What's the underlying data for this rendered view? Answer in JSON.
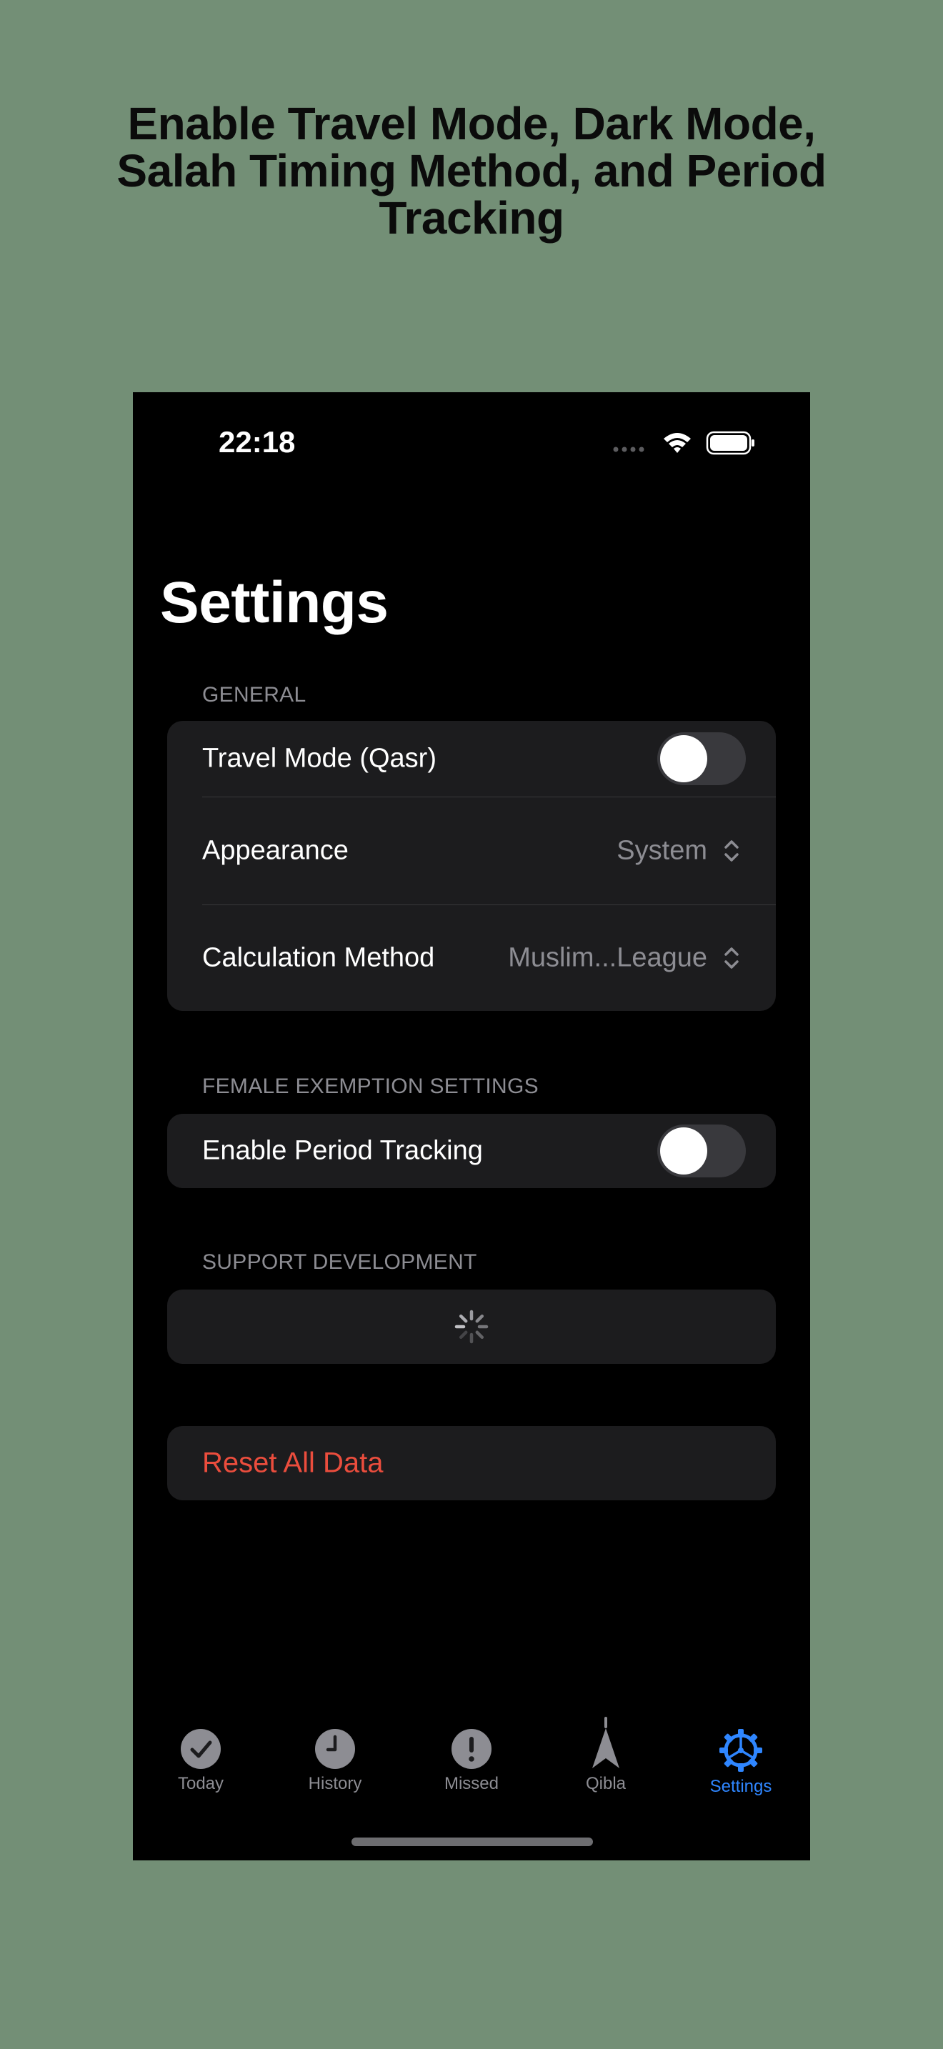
{
  "headline": "Enable Travel Mode, Dark Mode,\nSalah Timing Method, and Period\nTracking",
  "status_bar": {
    "time": "22:18"
  },
  "page_title": "Settings",
  "sections": {
    "general": {
      "header": "GENERAL",
      "travel_mode": {
        "label": "Travel Mode (Qasr)",
        "enabled": false
      },
      "appearance": {
        "label": "Appearance",
        "value": "System"
      },
      "calculation_method": {
        "label": "Calculation Method",
        "value": "Muslim...League"
      }
    },
    "female_exemption": {
      "header": "FEMALE EXEMPTION SETTINGS",
      "period_tracking": {
        "label": "Enable Period Tracking",
        "enabled": false
      }
    },
    "support": {
      "header": "SUPPORT DEVELOPMENT"
    },
    "reset": {
      "label": "Reset All Data"
    }
  },
  "tabs": [
    {
      "label": "Today",
      "icon": "checkmark-circle-icon"
    },
    {
      "label": "History",
      "icon": "clock-icon"
    },
    {
      "label": "Missed",
      "icon": "exclamation-circle-icon"
    },
    {
      "label": "Qibla",
      "icon": "compass-arrow-icon"
    },
    {
      "label": "Settings",
      "icon": "gear-icon",
      "active": true
    }
  ],
  "colors": {
    "accent": "#2f86ff",
    "destructive": "#eb4d3d",
    "background": "#738f76",
    "card": "#1c1c1e"
  }
}
